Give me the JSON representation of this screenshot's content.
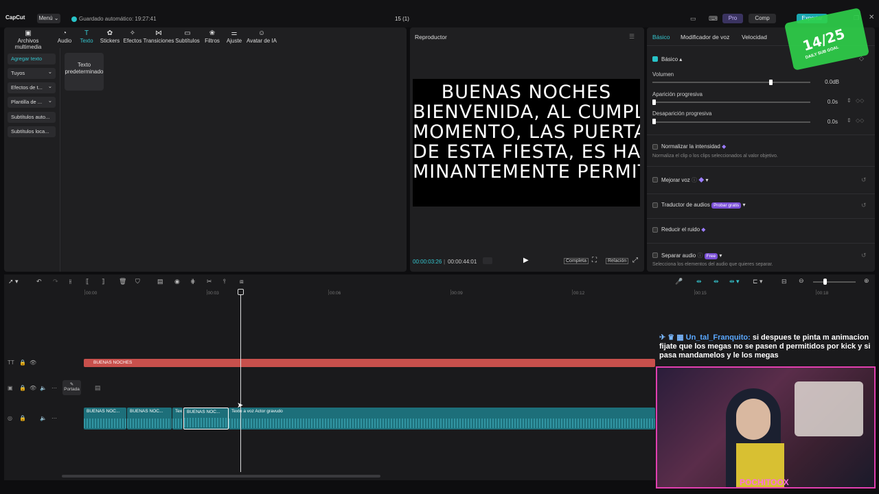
{
  "app": {
    "logo": "CapCut",
    "menu_label": "Menú",
    "autosave": "Guardado automático: 19:27:41",
    "project_title": "15 (1)",
    "pro_label": "Pro",
    "compartir_label": "Comp",
    "export_label": "Exportar"
  },
  "toolbar": {
    "tabs": [
      {
        "label": "Archivos multimedia",
        "icon": "media-icon"
      },
      {
        "label": "Audio",
        "icon": "audio-icon"
      },
      {
        "label": "Texto",
        "icon": "text-icon",
        "active": true
      },
      {
        "label": "Stickers",
        "icon": "sticker-icon"
      },
      {
        "label": "Efectos",
        "icon": "effects-icon"
      },
      {
        "label": "Transiciones",
        "icon": "transition-icon"
      },
      {
        "label": "Subtítulos",
        "icon": "subtitle-icon"
      },
      {
        "label": "Filtros",
        "icon": "filter-icon"
      },
      {
        "label": "Ajuste",
        "icon": "adjust-icon"
      },
      {
        "label": "Avatar de IA",
        "icon": "avatar-icon"
      }
    ]
  },
  "sidebar": {
    "items": [
      "Agregar texto",
      "Tuyos",
      "Efectos de t...",
      "Plantilla de ...",
      "Subtítulos auto...",
      "Subtítulos loca..."
    ]
  },
  "text_card": {
    "label": "Texto predeterminado"
  },
  "player": {
    "title": "Reproductor",
    "caption_lines": [
      "BUENAS NOCHES",
      "BIENVENIDA, AL CUMPLI",
      "MOMENTO, LAS PUERTAS",
      "DE ESTA FIESTA, ES HAS",
      "MINANTEMENTE PERMITI"
    ],
    "current_time": "00:00:03:26",
    "total_time": "00:00:44:01",
    "full_label": "Completa",
    "ratio_label": "Relación"
  },
  "right_panel": {
    "tabs": [
      "Básico",
      "Modificador de voz",
      "Velocidad"
    ],
    "section": "Básico",
    "volume_label": "Volumen",
    "volume_value": "0.0dB",
    "fade_in_label": "Aparición progresiva",
    "fade_in_value": "0.0s",
    "fade_out_label": "Desaparición progresiva",
    "fade_out_value": "0.0s",
    "normalize_label": "Normalizar la intensidad",
    "normalize_desc": "Normaliza el clip o los clips seleccionados al valor objetivo.",
    "enhance_label": "Mejorar voz",
    "translate_label": "Traductor de audios",
    "translate_badge": "Probar gratis",
    "noise_label": "Reducir el ruido",
    "separate_label": "Separar audio",
    "separate_badge": "Free",
    "separate_desc": "Selecciona los elementos del audio que quieres separar."
  },
  "timeline": {
    "ticks": [
      "00:00",
      "00:03",
      "00:06",
      "00:09",
      "00:12",
      "00:15",
      "00:18"
    ],
    "text_clip": "BUENAS NOCHES",
    "cover_label": "Portada",
    "audio_clips": [
      "BUENAS NOC...",
      "BUENAS NOC...",
      "Tex",
      "BUENAS NOC...",
      "Texto a voz Actor gravudo"
    ]
  },
  "stream": {
    "chat_user": "Un_tal_Franquito:",
    "chat_text": "si despues te pinta m animacion fijate que los megas no se pasen d permitidos por kick y si pasa mandamelos y le los megas",
    "goal": "14/25",
    "goal_label": "DAILY SUB GOAL",
    "cam_name": "POCHITOOX"
  },
  "colors": {
    "accent": "#35c7d0",
    "text_clip": "#c8504c",
    "audio_clip": "#1d6f7a"
  }
}
